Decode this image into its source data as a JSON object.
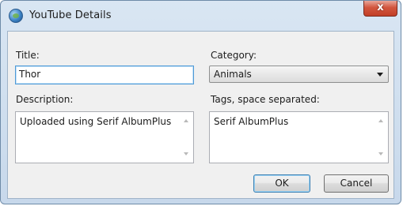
{
  "window": {
    "title": "YouTube Details",
    "close_glyph": "x"
  },
  "form": {
    "title_label": "Title:",
    "title_value": "Thor",
    "category_label": "Category:",
    "category_value": "Animals",
    "description_label": "Description:",
    "description_value": "Uploaded using Serif AlbumPlus",
    "tags_label": "Tags, space separated:",
    "tags_value": "Serif AlbumPlus"
  },
  "buttons": {
    "ok_label": "OK",
    "cancel_label": "Cancel"
  },
  "icons": {
    "app": "globe-icon",
    "close": "close-icon",
    "dropdown": "chevron-down-icon",
    "scroll_up": "scroll-up-arrow-icon",
    "scroll_down": "scroll-down-arrow-icon"
  }
}
